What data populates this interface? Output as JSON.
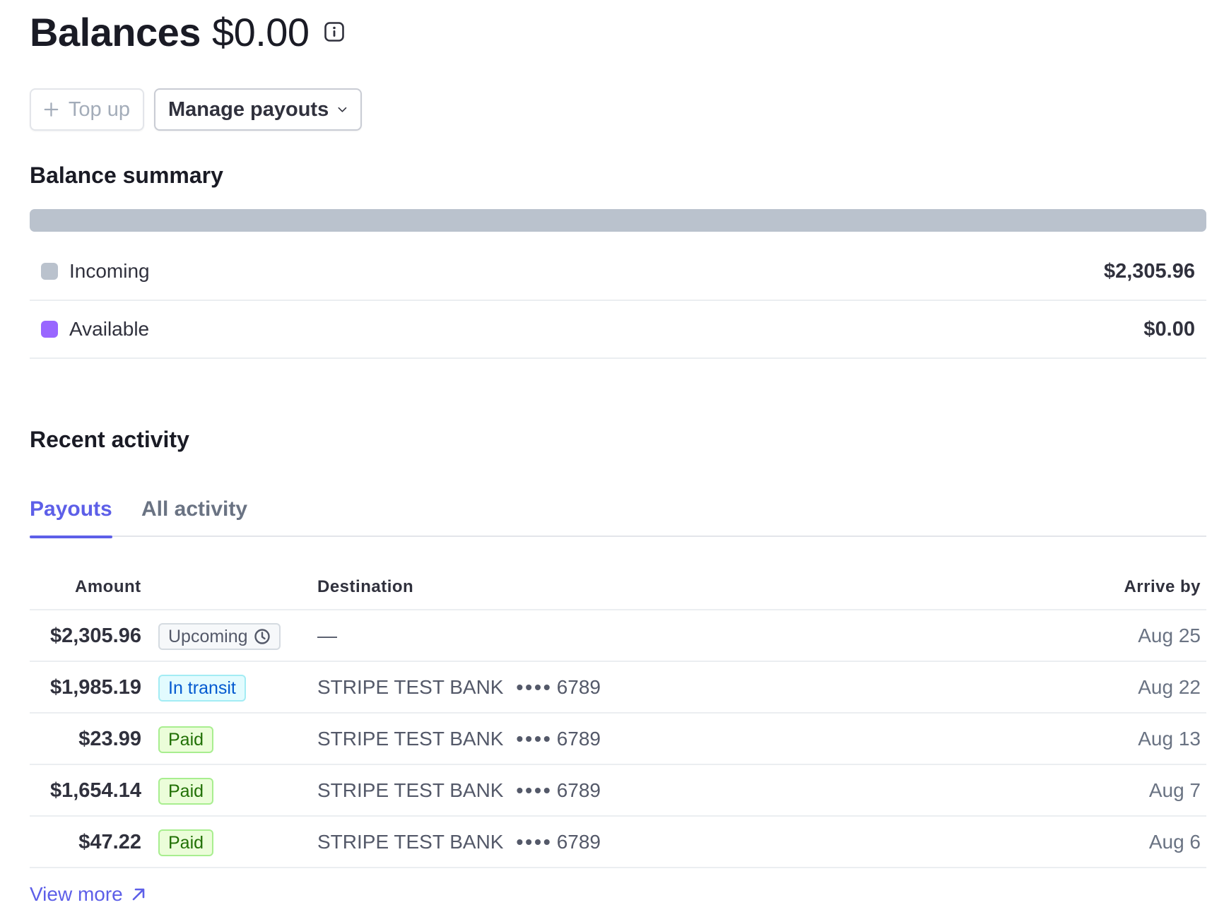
{
  "header": {
    "title": "Balances",
    "total": "$0.00",
    "info_icon": "info-icon"
  },
  "actions": {
    "top_up_label": "Top up",
    "manage_payouts_label": "Manage payouts"
  },
  "balance_summary": {
    "title": "Balance summary",
    "rows": [
      {
        "label": "Incoming",
        "value": "$2,305.96",
        "color": "#bac2cd"
      },
      {
        "label": "Available",
        "value": "$0.00",
        "color": "#9966ff"
      }
    ]
  },
  "recent_activity": {
    "title": "Recent activity",
    "tabs": [
      {
        "label": "Payouts",
        "active": true
      },
      {
        "label": "All activity",
        "active": false
      }
    ],
    "columns": {
      "amount": "Amount",
      "destination": "Destination",
      "arrive_by": "Arrive by"
    },
    "payouts": [
      {
        "amount": "$2,305.96",
        "status": "Upcoming",
        "destination": "—",
        "last4": "",
        "arrive_by": "Aug 25"
      },
      {
        "amount": "$1,985.19",
        "status": "In transit",
        "destination": "STRIPE TEST BANK",
        "last4": "6789",
        "arrive_by": "Aug 22"
      },
      {
        "amount": "$23.99",
        "status": "Paid",
        "destination": "STRIPE TEST BANK",
        "last4": "6789",
        "arrive_by": "Aug 13"
      },
      {
        "amount": "$1,654.14",
        "status": "Paid",
        "destination": "STRIPE TEST BANK",
        "last4": "6789",
        "arrive_by": "Aug 7"
      },
      {
        "amount": "$47.22",
        "status": "Paid",
        "destination": "STRIPE TEST BANK",
        "last4": "6789",
        "arrive_by": "Aug 6"
      }
    ],
    "masked_dots": "••••",
    "view_more_label": "View more"
  },
  "colors": {
    "accent": "#5d5fe8",
    "incoming": "#bac2cd",
    "available": "#9966ff"
  }
}
